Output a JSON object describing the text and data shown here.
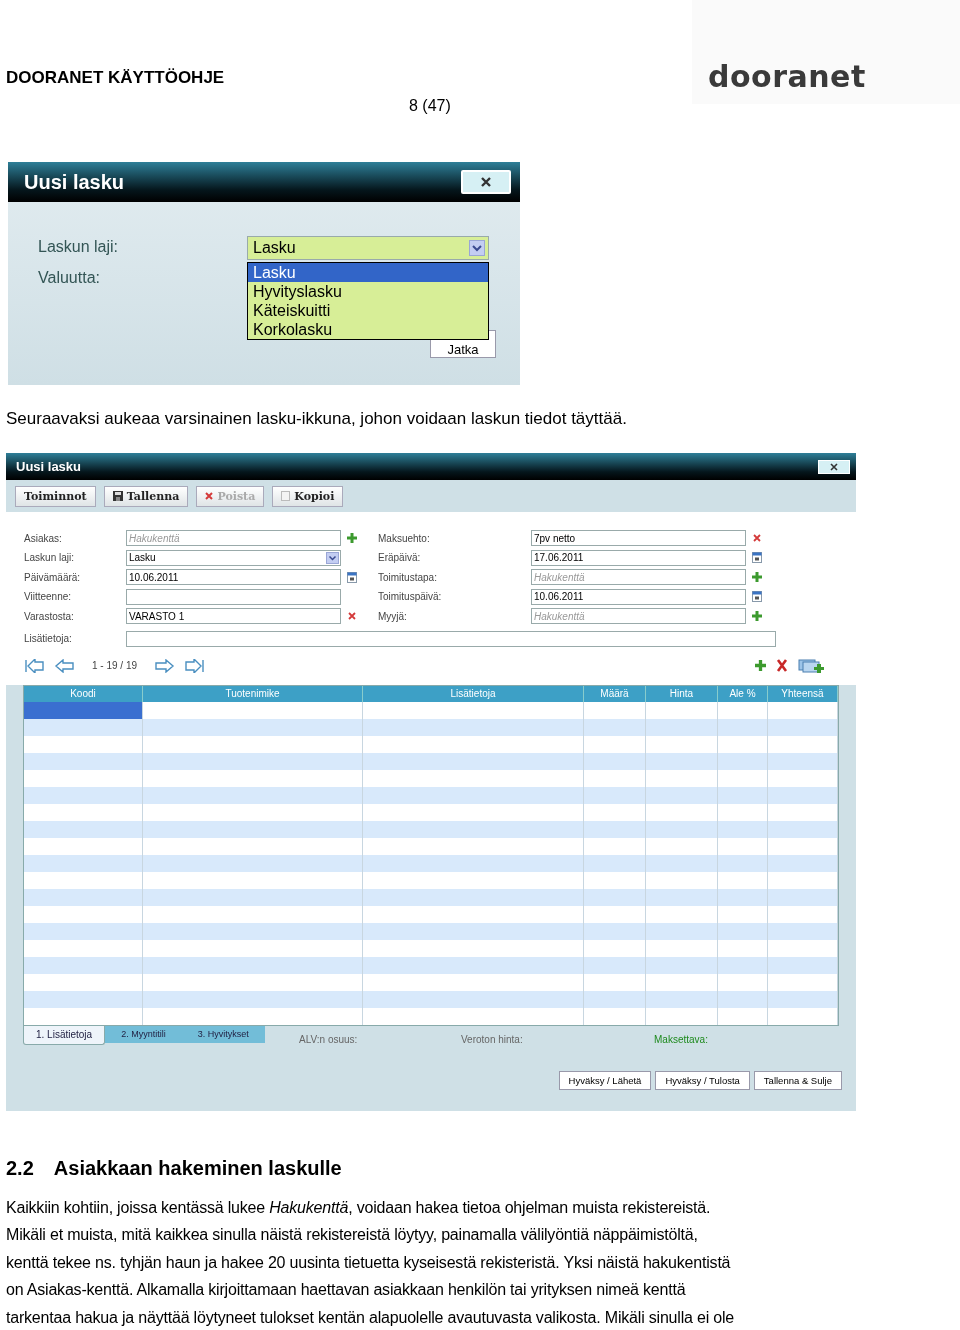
{
  "header": {
    "title": "DOORANET KÄYTTÖOHJE",
    "page": "8 (47)",
    "logo": "dooranet"
  },
  "dialog": {
    "title": "Uusi lasku",
    "fields": [
      {
        "label": "Laskun laji:",
        "value": "Lasku"
      },
      {
        "label": "Valuutta:"
      }
    ],
    "options": [
      {
        "label": "Lasku",
        "selected": true
      },
      {
        "label": "Hyvityslasku",
        "selected": false
      },
      {
        "label": "Käteiskuitti",
        "selected": false
      },
      {
        "label": "Korkolasku",
        "selected": false
      }
    ],
    "button": "Jatka"
  },
  "caption": "Seuraavaksi aukeaa varsinainen lasku-ikkuna, johon voidaan laskun tiedot täyttää.",
  "window": {
    "title": "Uusi lasku",
    "toolbar": [
      {
        "label": "Toiminnot",
        "disabled": false
      },
      {
        "label": "Tallenna",
        "disabled": false
      },
      {
        "label": "Poista",
        "disabled": true
      },
      {
        "label": "Kopioi",
        "disabled": false
      }
    ],
    "left_fields": [
      {
        "label": "Asiakas:",
        "placeholder": "Hakukenttä",
        "kind": "text"
      },
      {
        "label": "Laskun laji:",
        "value": "Lasku",
        "kind": "select"
      },
      {
        "label": "Päivämäärä:",
        "value": "10.06.2011",
        "kind": "text"
      },
      {
        "label": "Viitteenne:",
        "kind": "text"
      },
      {
        "label": "Varastosta:",
        "value": "VARASTO 1",
        "kind": "text"
      }
    ],
    "right_fields": [
      {
        "label": "Maksuehto:",
        "value": "7pv netto",
        "kind": "text"
      },
      {
        "label": "Eräpäivä:",
        "value": "17.06.2011",
        "kind": "text"
      },
      {
        "label": "Toimitustapa:",
        "placeholder": "Hakukenttä",
        "kind": "text"
      },
      {
        "label": "Toimituspäivä:",
        "value": "10.06.2011",
        "kind": "text"
      },
      {
        "label": "Myyjä:",
        "placeholder": "Hakukenttä",
        "kind": "text"
      }
    ],
    "notes_label": "Lisätietoja:",
    "pager": "1 - 19 / 19",
    "columns": [
      "Koodi",
      "Tuotenimike",
      "Lisätietoja",
      "Määrä",
      "Hinta",
      "Ale %",
      "Yhteensä"
    ],
    "rows": [
      {
        "selected": true
      },
      {
        "selected": false
      },
      {
        "selected": false
      },
      {
        "selected": false
      },
      {
        "selected": false
      },
      {
        "selected": false
      },
      {
        "selected": false
      },
      {
        "selected": false
      },
      {
        "selected": false
      },
      {
        "selected": false
      },
      {
        "selected": false
      },
      {
        "selected": false
      },
      {
        "selected": false
      },
      {
        "selected": false
      },
      {
        "selected": false
      },
      {
        "selected": false
      },
      {
        "selected": false
      },
      {
        "selected": false
      },
      {
        "selected": false
      }
    ],
    "tabs": [
      {
        "label": "1. Lisätietoja",
        "selected": true
      },
      {
        "label": "2. Myyntitili",
        "selected": false
      },
      {
        "label": "3. Hyvitykset",
        "selected": false
      }
    ],
    "totals": [
      {
        "label": "ALV:n osuus:",
        "highlight": false
      },
      {
        "label": "Veroton hinta:",
        "highlight": false
      },
      {
        "label": "Maksettava:",
        "highlight": true
      }
    ],
    "buttons": [
      "Hyväksy / Lähetä",
      "Hyväksy / Tulosta",
      "Tallenna & Sulje"
    ]
  },
  "section": {
    "number": "2.2",
    "title": "Asiakkaan hakeminen laskulle",
    "lines": [
      "Kaikkiin kohtiin, joissa kentässä lukee *Hakukenttä*, voidaan hakea tietoa ohjelman muista rekistereistä.",
      "Mikäli et muista, mitä kaikkea sinulla näistä rekistereistä löytyy, painamalla välilyöntiä näppäimistöltä,",
      "kenttä tekee ns. tyhjän haun ja hakee 20 uusinta tietuetta kyseisestä rekisteristä. Yksi näistä hakukentistä",
      "on Asiakas-kenttä. Alkamalla kirjoittamaan haettavan asiakkaan henkilön tai yrityksen nimeä kenttä",
      "tarkentaa hakua ja näyttää löytyneet tulokset kentän alapuolelle avautuvasta valikosta. Mikäli sinulla ei ole"
    ]
  }
}
